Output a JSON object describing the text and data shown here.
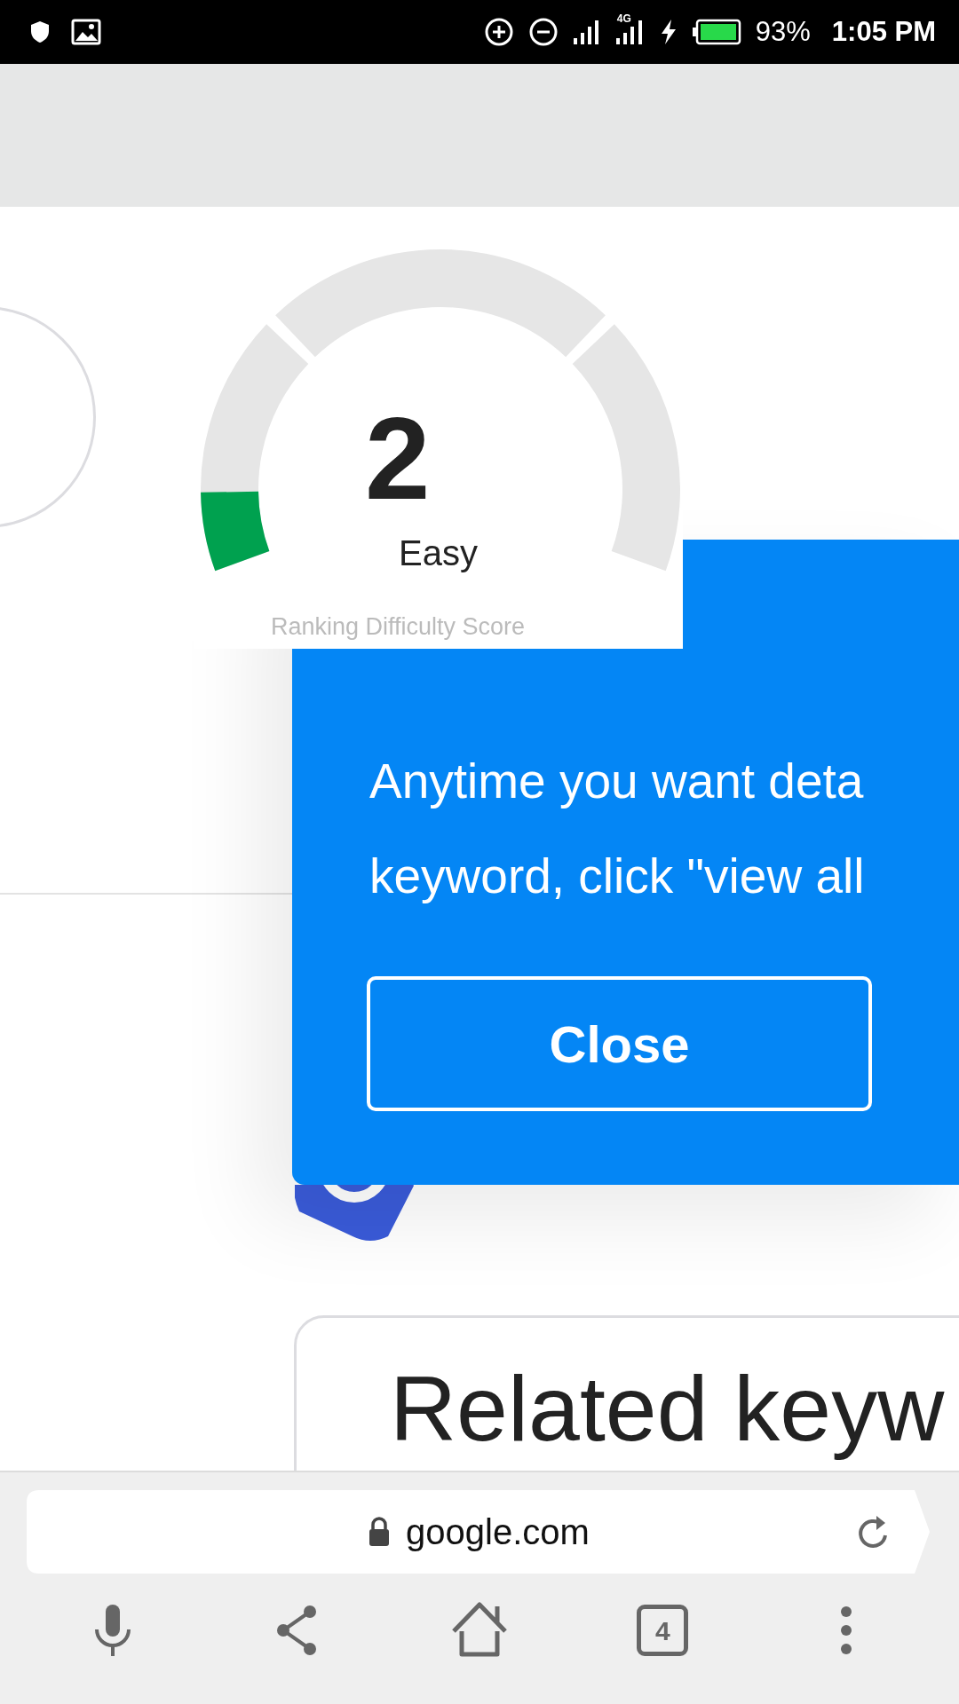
{
  "status_bar": {
    "network_type": "4G",
    "battery": "93%",
    "time": "1:05 PM"
  },
  "gauge": {
    "score": "2",
    "rating": "Easy",
    "caption": "Ranking Difficulty Score",
    "level": 0.08
  },
  "popup": {
    "lines": [
      "Anytime you want deta",
      "keyword, click \"view all"
    ],
    "button": "Close"
  },
  "related_card": {
    "title": "Related keyw"
  },
  "browser": {
    "url": "google.com",
    "tab_count": "4"
  }
}
